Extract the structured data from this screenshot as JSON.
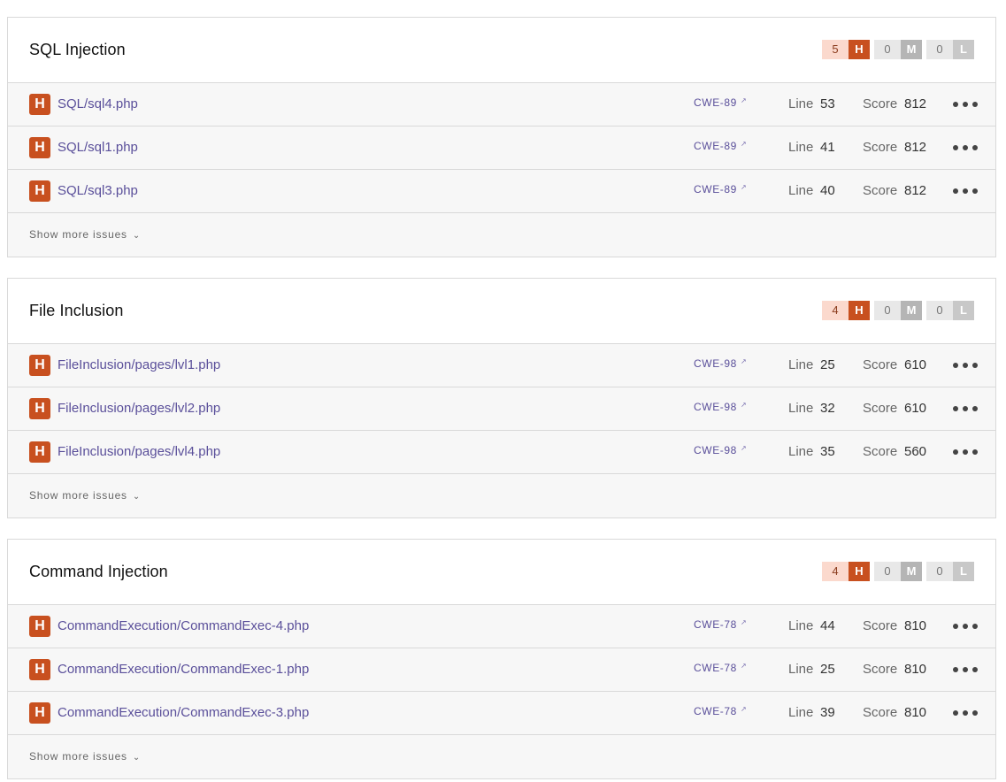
{
  "panels": [
    {
      "title": "SQL Injection",
      "counts": {
        "high": "5",
        "high_letter": "H",
        "medium": "0",
        "medium_letter": "M",
        "low": "0",
        "low_letter": "L"
      },
      "issues": [
        {
          "severity": "H",
          "file": "SQL/sql4.php",
          "cwe": "CWE-89",
          "line_label": "Line",
          "line": "53",
          "score_label": "Score",
          "score": "812"
        },
        {
          "severity": "H",
          "file": "SQL/sql1.php",
          "cwe": "CWE-89",
          "line_label": "Line",
          "line": "41",
          "score_label": "Score",
          "score": "812"
        },
        {
          "severity": "H",
          "file": "SQL/sql3.php",
          "cwe": "CWE-89",
          "line_label": "Line",
          "line": "40",
          "score_label": "Score",
          "score": "812"
        }
      ],
      "show_more": "Show more issues"
    },
    {
      "title": "File Inclusion",
      "counts": {
        "high": "4",
        "high_letter": "H",
        "medium": "0",
        "medium_letter": "M",
        "low": "0",
        "low_letter": "L"
      },
      "issues": [
        {
          "severity": "H",
          "file": "FileInclusion/pages/lvl1.php",
          "cwe": "CWE-98",
          "line_label": "Line",
          "line": "25",
          "score_label": "Score",
          "score": "610"
        },
        {
          "severity": "H",
          "file": "FileInclusion/pages/lvl2.php",
          "cwe": "CWE-98",
          "line_label": "Line",
          "line": "32",
          "score_label": "Score",
          "score": "610"
        },
        {
          "severity": "H",
          "file": "FileInclusion/pages/lvl4.php",
          "cwe": "CWE-98",
          "line_label": "Line",
          "line": "35",
          "score_label": "Score",
          "score": "560"
        }
      ],
      "show_more": "Show more issues"
    },
    {
      "title": "Command Injection",
      "counts": {
        "high": "4",
        "high_letter": "H",
        "medium": "0",
        "medium_letter": "M",
        "low": "0",
        "low_letter": "L"
      },
      "issues": [
        {
          "severity": "H",
          "file": "CommandExecution/CommandExec-4.php",
          "cwe": "CWE-78",
          "line_label": "Line",
          "line": "44",
          "score_label": "Score",
          "score": "810"
        },
        {
          "severity": "H",
          "file": "CommandExecution/CommandExec-1.php",
          "cwe": "CWE-78",
          "line_label": "Line",
          "line": "25",
          "score_label": "Score",
          "score": "810"
        },
        {
          "severity": "H",
          "file": "CommandExecution/CommandExec-3.php",
          "cwe": "CWE-78",
          "line_label": "Line",
          "line": "39",
          "score_label": "Score",
          "score": "810"
        }
      ],
      "show_more": "Show more issues"
    }
  ],
  "icons": {
    "external_link": "external-link-icon",
    "more": "more-dots-icon",
    "chevron": "chevron-down-icon"
  }
}
